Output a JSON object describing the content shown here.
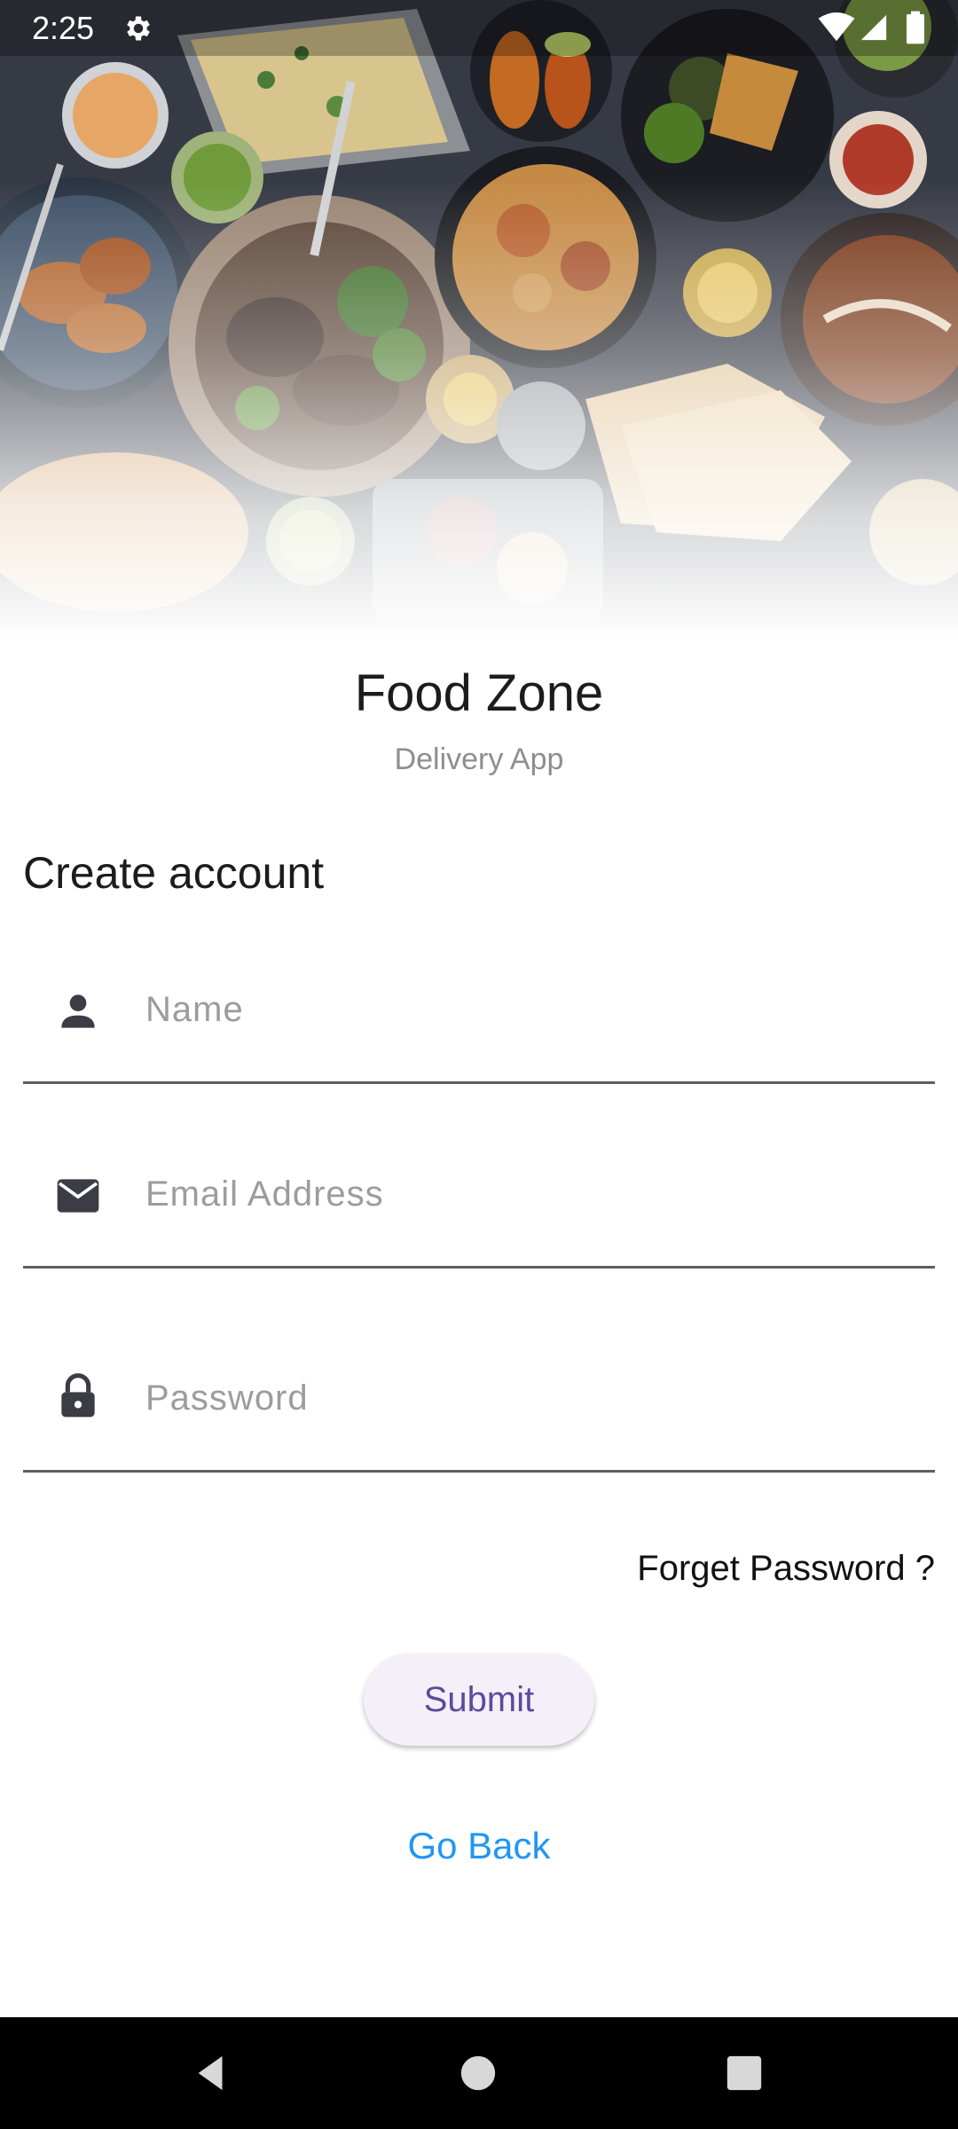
{
  "status_bar": {
    "time": "2:25",
    "icons": [
      "gear-icon",
      "wifi-icon",
      "signal-icon",
      "battery-icon"
    ]
  },
  "hero": {
    "image": "food-spread-photo"
  },
  "header": {
    "title": "Food Zone",
    "subtitle": "Delivery App"
  },
  "form": {
    "heading": "Create account",
    "fields": [
      {
        "icon": "person-icon",
        "placeholder": "Name",
        "value": ""
      },
      {
        "icon": "mail-icon",
        "placeholder": "Email Address",
        "value": ""
      },
      {
        "icon": "lock-icon",
        "placeholder": "Password",
        "value": ""
      }
    ],
    "forgot_label": "Forget Password ?",
    "submit_label": "Submit",
    "go_back_label": "Go Back"
  },
  "nav_bar": {
    "buttons": [
      "back-triangle-icon",
      "home-circle-icon",
      "recents-square-icon"
    ]
  },
  "colors": {
    "submit_text": "#5b4a9c",
    "submit_bg": "#f4eff8",
    "link_blue": "#2196f3",
    "input_line": "#5f5f5f",
    "icon_dark": "#3c3c44"
  }
}
